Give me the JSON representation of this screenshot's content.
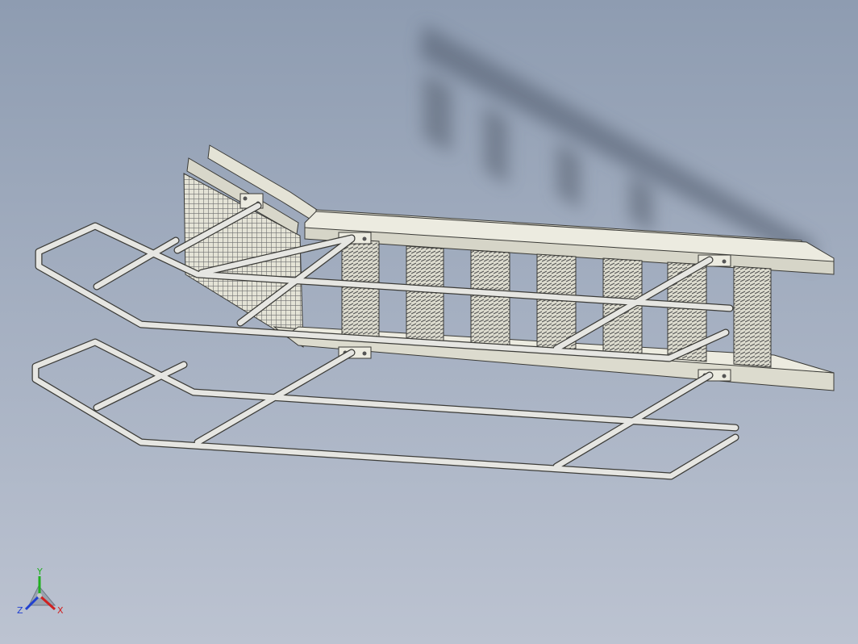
{
  "viewport": {
    "background_top": "#8e9cb1",
    "background_bottom": "#bcc3d1",
    "model_color": "#e4e3d6",
    "rail_color": "#e6e6e2",
    "grating_color": "#6f6f6f"
  },
  "triad": {
    "x_label": "X",
    "y_label": "Y",
    "z_label": "Z",
    "x_color": "#d02020",
    "y_color": "#20b020",
    "z_color": "#2040d0"
  }
}
